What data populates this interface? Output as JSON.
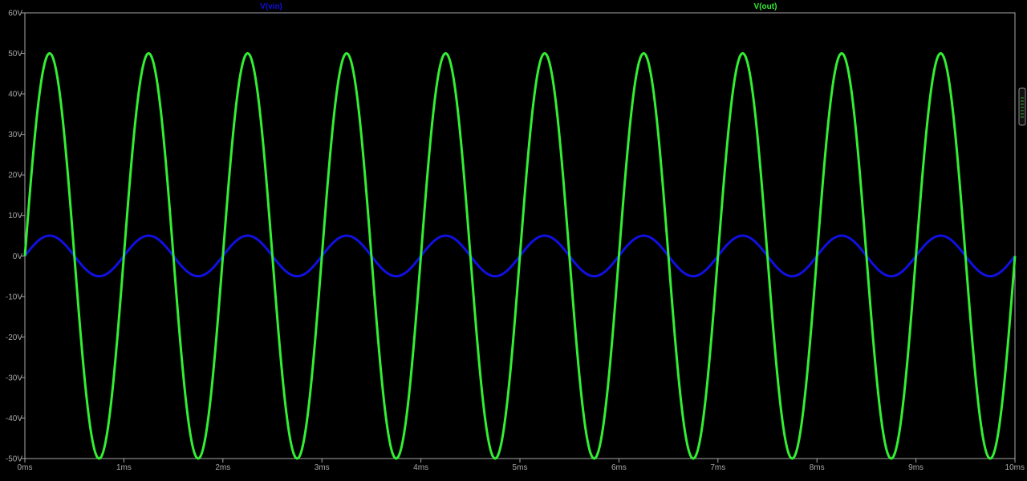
{
  "chart_data": {
    "type": "line",
    "title": "",
    "xlabel": "",
    "ylabel": "",
    "xlim": [
      0,
      10
    ],
    "ylim": [
      -50,
      60
    ],
    "x_unit": "ms",
    "y_unit": "V",
    "x_ticks": [
      {
        "value": 0,
        "label": "0ms"
      },
      {
        "value": 1,
        "label": "1ms"
      },
      {
        "value": 2,
        "label": "2ms"
      },
      {
        "value": 3,
        "label": "3ms"
      },
      {
        "value": 4,
        "label": "4ms"
      },
      {
        "value": 5,
        "label": "5ms"
      },
      {
        "value": 6,
        "label": "6ms"
      },
      {
        "value": 7,
        "label": "7ms"
      },
      {
        "value": 8,
        "label": "8ms"
      },
      {
        "value": 9,
        "label": "9ms"
      },
      {
        "value": 10,
        "label": "10ms"
      }
    ],
    "y_ticks": [
      {
        "value": 60,
        "label": "60V"
      },
      {
        "value": 50,
        "label": "50V"
      },
      {
        "value": 40,
        "label": "40V"
      },
      {
        "value": 30,
        "label": "30V"
      },
      {
        "value": 20,
        "label": "20V"
      },
      {
        "value": 10,
        "label": "10V"
      },
      {
        "value": 0,
        "label": "0V"
      },
      {
        "value": -10,
        "label": "-10V"
      },
      {
        "value": -20,
        "label": "-20V"
      },
      {
        "value": -30,
        "label": "-30V"
      },
      {
        "value": -40,
        "label": "-40V"
      },
      {
        "value": -50,
        "label": "-50V"
      }
    ],
    "grid": false,
    "legend": "top",
    "series": [
      {
        "name": "V(vin)",
        "color": "#1010e0",
        "waveform": "sine",
        "amplitude": 5,
        "frequency_khz": 1,
        "phase_deg": 0,
        "offset": 0
      },
      {
        "name": "V(out)",
        "color": "#33ee33",
        "waveform": "sine",
        "amplitude": 50,
        "frequency_khz": 1,
        "phase_deg": 0,
        "offset": 0
      }
    ]
  }
}
